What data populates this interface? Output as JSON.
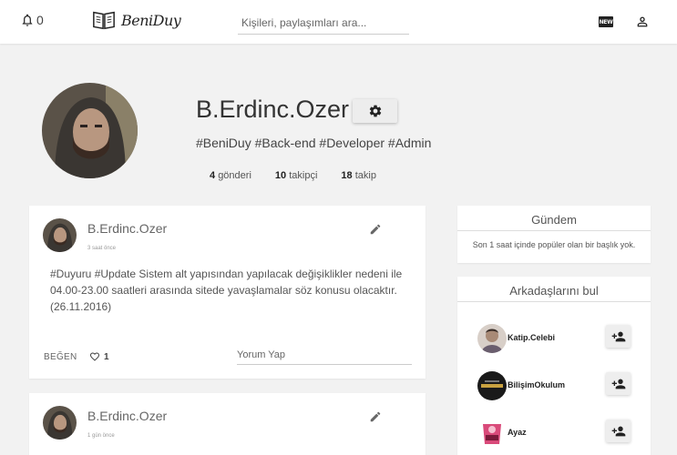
{
  "topbar": {
    "notification_count": "0",
    "logo_text": "BeniDuy",
    "search_placeholder": "Kişileri, paylaşımları ara...",
    "new_badge": "NEW"
  },
  "profile": {
    "name": "B.Erdinc.Ozer",
    "tags": "#BeniDuy #Back-end #Developer #Admin",
    "stats": [
      {
        "count": "4",
        "label": "gönderi"
      },
      {
        "count": "10",
        "label": "takipçi"
      },
      {
        "count": "18",
        "label": "takip"
      }
    ]
  },
  "posts": [
    {
      "author": "B.Erdinc.Ozer",
      "time": "3 saat önce",
      "text": "#Duyuru #Update Sistem alt yapısından yapılacak değişiklikler nedeni ile 04.00-23.00 saatleri arasında sitede yavaşlamalar söz konusu olacaktır. (26.11.2016)",
      "like_label": "BEĞEN",
      "like_count": "1",
      "comment_placeholder": "Yorum Yap"
    },
    {
      "author": "B.Erdinc.Ozer",
      "time": "1 gün önce"
    }
  ],
  "trend": {
    "title": "Gündem",
    "text": "Son 1 saat içinde popüler olan bir başlık yok."
  },
  "friends": {
    "title": "Arkadaşlarını bul",
    "items": [
      {
        "name": "Katip.Celebi"
      },
      {
        "name": "BilişimOkulum"
      },
      {
        "name": "Ayaz"
      }
    ]
  },
  "icons": {
    "notification": "bell-icon",
    "logo": "book-icon",
    "user": "person-icon",
    "settings": "gear-icon",
    "edit": "pencil-icon",
    "like": "heart-outline-icon",
    "add_friend": "person-add-icon"
  }
}
